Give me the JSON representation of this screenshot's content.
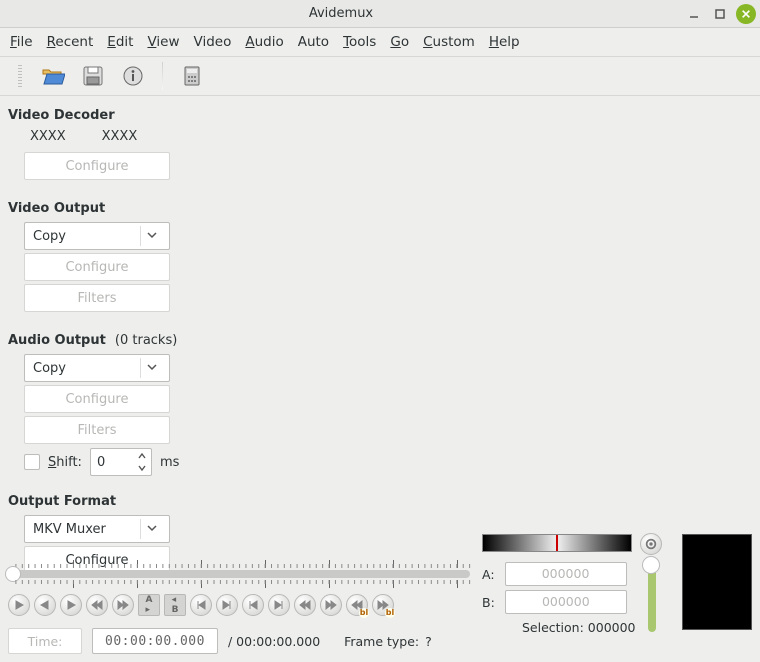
{
  "title": "Avidemux",
  "menubar": [
    {
      "label": "File",
      "mn": "F"
    },
    {
      "label": "Recent",
      "mn": "R"
    },
    {
      "label": "Edit",
      "mn": "E"
    },
    {
      "label": "View",
      "mn": "V"
    },
    {
      "label": "Video",
      "mn": "V"
    },
    {
      "label": "Audio",
      "mn": "A"
    },
    {
      "label": "Auto",
      "mn": "A"
    },
    {
      "label": "Tools",
      "mn": "T"
    },
    {
      "label": "Go",
      "mn": "G"
    },
    {
      "label": "Custom",
      "mn": "C"
    },
    {
      "label": "Help",
      "mn": "H"
    }
  ],
  "decoder": {
    "heading": "Video Decoder",
    "info1": "XXXX",
    "info2": "XXXX",
    "configure": "Configure"
  },
  "video_out": {
    "heading": "Video Output",
    "codec": "Copy",
    "configure": "Configure",
    "filters": "Filters"
  },
  "audio_out": {
    "heading": "Audio Output",
    "tracks_suffix": "(0 tracks)",
    "codec": "Copy",
    "configure": "Configure",
    "filters": "Filters",
    "shift_label": "Shift:",
    "shift_value": "0",
    "shift_unit": "ms"
  },
  "output_format": {
    "heading": "Output Format",
    "muxer": "MKV Muxer",
    "configure": "Configure"
  },
  "timeline": {
    "time_label": "Time:",
    "timecode": "00:00:00.000",
    "duration": "/ 00:00:00.000",
    "frametype_label": "Frame type:",
    "frametype_value": "?"
  },
  "selection": {
    "a_label": "A:",
    "a_value": "000000",
    "b_label": "B:",
    "b_value": "000000",
    "sel_label": "Selection: 000000"
  }
}
